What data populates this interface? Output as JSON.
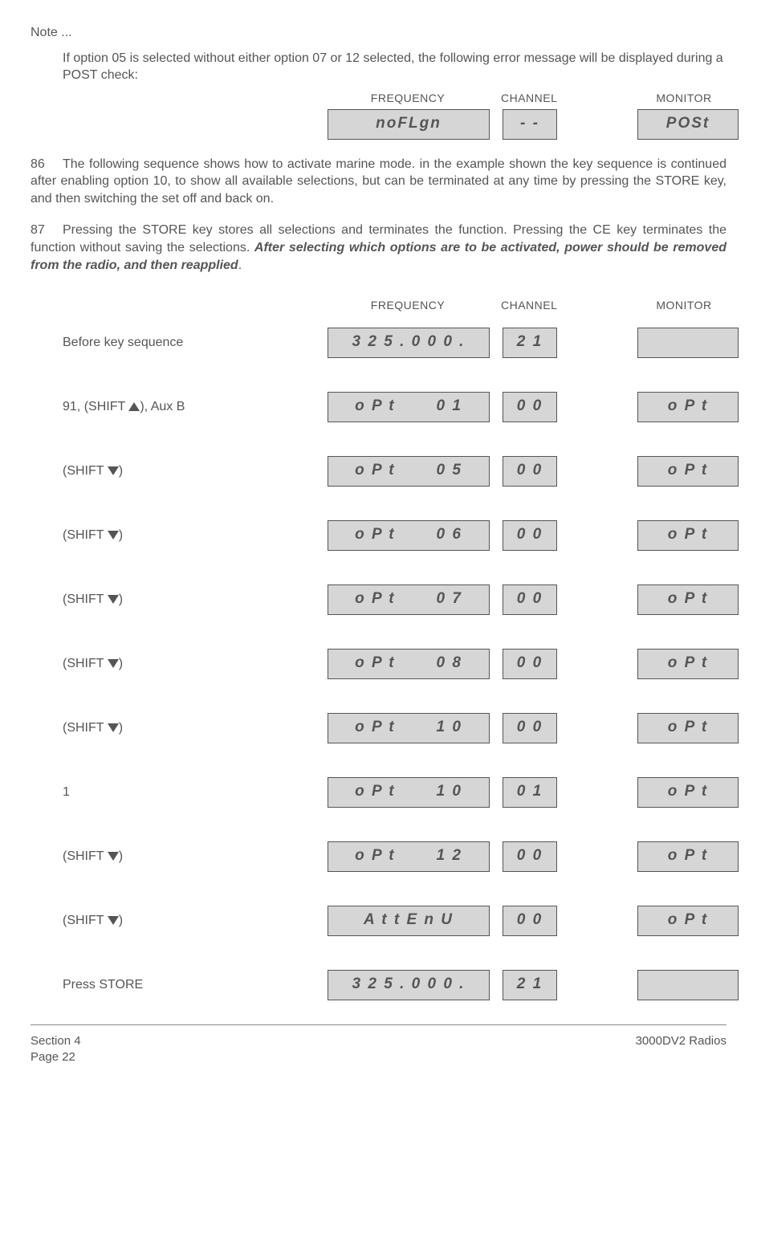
{
  "note_label": "Note ...",
  "note_text": "If option 05 is selected without either option 07 or 12 selected, the following error message will be displayed during a POST check:",
  "headers": {
    "freq": "FREQUENCY",
    "chan": "CHANNEL",
    "mon": "MONITOR"
  },
  "error": {
    "freq": "noFLgn",
    "chan": "- -",
    "mon": "POSt"
  },
  "para86_num": "86",
  "para86": "The following sequence shows how to activate marine mode. in the example shown the key sequence is continued after enabling option 10, to show all available selections, but can be terminated at any time by pressing the STORE key, and then switching the set off and back on.",
  "para87_num": "87",
  "para87a": "Pressing the STORE key stores all selections and terminates the function. Pressing the CE key terminates the function without saving the selections. ",
  "para87b": "After selecting which options are to be activated, power should be removed from the radio, and then reapplied",
  "para87c": ".",
  "seq": [
    {
      "label_pre": "Before key sequence",
      "arrow": "",
      "label_post": "",
      "freq": "3 2 5 . 0 0 0 .",
      "chan": "2 1",
      "mon": ""
    },
    {
      "label_pre": "91, (SHIFT ",
      "arrow": "up",
      "label_post": "), Aux B",
      "freq": "o P t       0 1",
      "chan": "0 0",
      "mon": "o P t"
    },
    {
      "label_pre": "(SHIFT ",
      "arrow": "down",
      "label_post": ")",
      "freq": "o P t       0 5",
      "chan": "0 0",
      "mon": "o P t"
    },
    {
      "label_pre": "(SHIFT ",
      "arrow": "down",
      "label_post": ")",
      "freq": "o P t       0 6",
      "chan": "0 0",
      "mon": "o P t"
    },
    {
      "label_pre": "(SHIFT ",
      "arrow": "down",
      "label_post": ")",
      "freq": "o P t       0 7",
      "chan": "0 0",
      "mon": "o P t"
    },
    {
      "label_pre": "(SHIFT ",
      "arrow": "down",
      "label_post": ")",
      "freq": "o P t       0 8",
      "chan": "0 0",
      "mon": "o P t"
    },
    {
      "label_pre": "(SHIFT ",
      "arrow": "down",
      "label_post": ")",
      "freq": "o P t       1 0",
      "chan": "0 0",
      "mon": "o P t"
    },
    {
      "label_pre": "1",
      "arrow": "",
      "label_post": "",
      "freq": "o P t       1 0",
      "chan": "0 1",
      "mon": "o P t"
    },
    {
      "label_pre": "(SHIFT ",
      "arrow": "down",
      "label_post": ")",
      "freq": "o P t       1 2",
      "chan": "0 0",
      "mon": "o P t"
    },
    {
      "label_pre": "(SHIFT ",
      "arrow": "down",
      "label_post": ")",
      "freq": "A t t E n U",
      "chan": "0 0",
      "mon": "o P t"
    },
    {
      "label_pre": "Press STORE",
      "arrow": "",
      "label_post": "",
      "freq": "3 2 5 . 0 0 0 .",
      "chan": "2 1",
      "mon": ""
    }
  ],
  "footer": {
    "left1": "Section 4",
    "left2": "Page 22",
    "right": "3000DV2 Radios"
  }
}
